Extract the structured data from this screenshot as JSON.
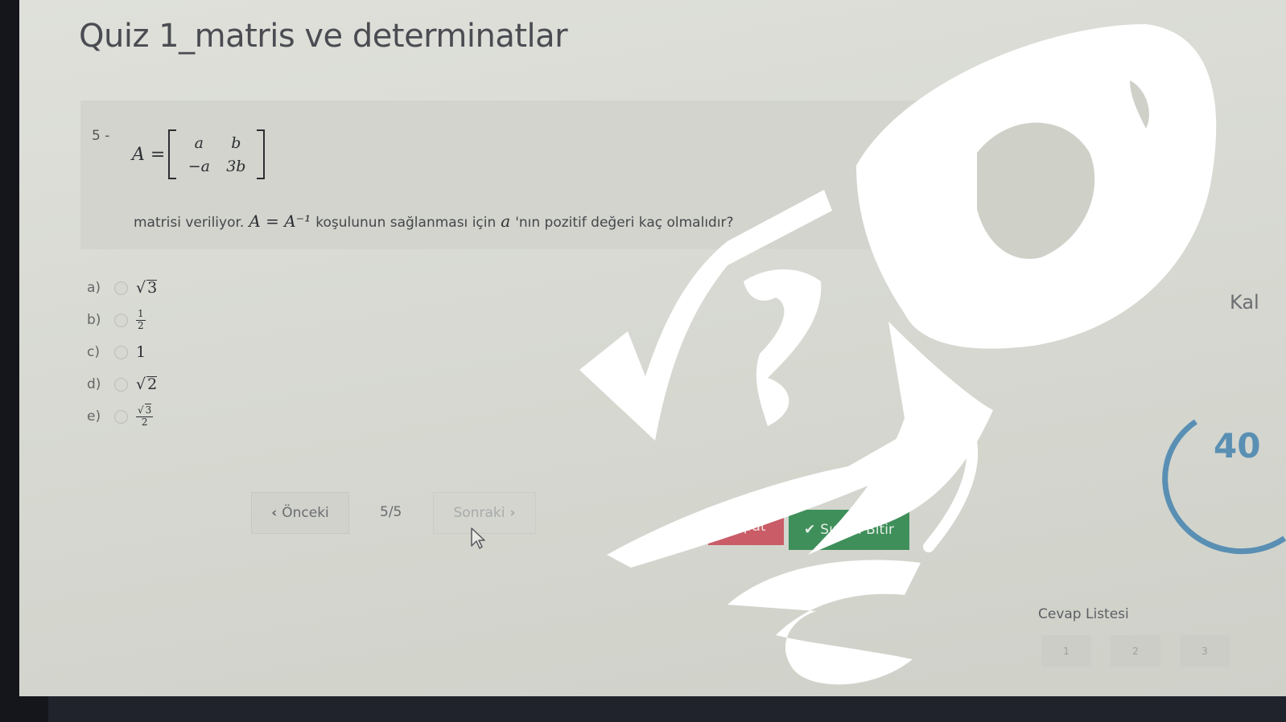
{
  "quiz": {
    "title": "Quiz 1_matris ve determinatlar"
  },
  "question": {
    "number": "5 -",
    "matrix": {
      "lhs": "A =",
      "rows": [
        [
          "a",
          "b"
        ],
        [
          "−a",
          "3b"
        ]
      ]
    },
    "text_before": "matrisi veriliyor.",
    "condition": "A = A⁻¹",
    "text_middle": "koşulunun sağlanması için",
    "variable": "a",
    "text_after": "'nın pozitif değeri kaç olmalıdır?"
  },
  "choices": [
    {
      "letter": "a)",
      "value": "3",
      "kind": "sqrt"
    },
    {
      "letter": "b)",
      "numerator": "1",
      "denominator": "2",
      "kind": "frac"
    },
    {
      "letter": "c)",
      "value": "1",
      "kind": "plain"
    },
    {
      "letter": "d)",
      "value": "2",
      "kind": "sqrt"
    },
    {
      "letter": "e)",
      "numerator": "3",
      "denominator": "2",
      "kind": "sqrt-frac"
    }
  ],
  "navigation": {
    "prev_label": "Önceki",
    "page_indicator": "5/5",
    "next_label": "Sonraki"
  },
  "actions": {
    "close_label": "Kapat",
    "finish_label": "Sınavı Bitir"
  },
  "sidebar": {
    "remaining_label": "Kal",
    "timer_value": "40",
    "answer_list_title": "Cevap Listesi",
    "answer_items": [
      "1",
      "2",
      "3"
    ]
  },
  "colors": {
    "close_button": "#c95c67",
    "finish_button": "#3f8f5a",
    "timer": "#5a8fb4"
  }
}
